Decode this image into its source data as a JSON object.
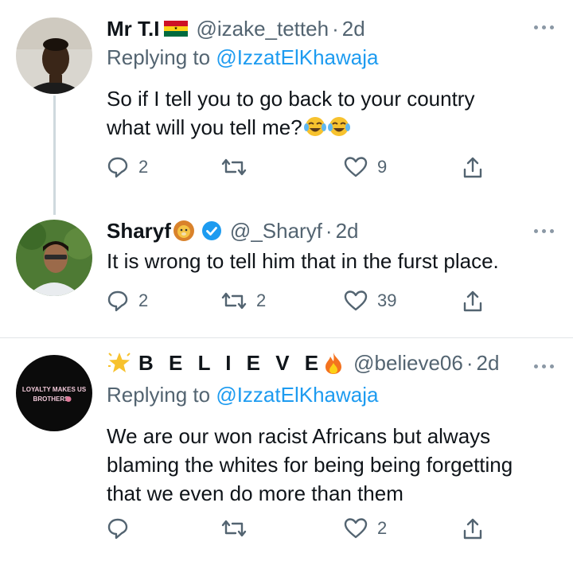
{
  "tweets": [
    {
      "name": "Mr T.I",
      "flag_icon": "ghana-flag-icon",
      "handle": "@izake_tetteh",
      "sep": "·",
      "time": "2d",
      "replying_prefix": "Replying to ",
      "replying_to": "@IzzatElKhawaja",
      "text_line1": "So if I tell you to go back to your country",
      "text_line2": "what will you tell me?",
      "text_emoji": "tears-of-joy-emoji",
      "reply_count": "2",
      "retweet_count": "",
      "like_count": "9"
    },
    {
      "name": "Sharyf",
      "name_emoji": "lion-face-emoji",
      "verified_icon": "verified-badge-icon",
      "handle": "@_Sharyf",
      "sep": "·",
      "time": "2d",
      "text": "It is wrong to tell him that in the furst place.",
      "reply_count": "2",
      "retweet_count": "2",
      "like_count": "39"
    },
    {
      "name_prefix_emoji": "glowing-star-emoji",
      "name": "B E L I E V E",
      "name_emoji": "fire-emoji",
      "handle": "@believe06",
      "sep": "·",
      "time": "2d",
      "replying_prefix": "Replying to ",
      "replying_to": "@IzzatElKhawaja",
      "avatar_text_line1": "LOYALTY MAKES US",
      "avatar_text_line2": "BROTHERS",
      "text_line1": "We are our won racist Africans but always",
      "text_line2": "blaming the whites for being being forgetting",
      "text_line3": "that we even do more than them",
      "reply_count": "",
      "retweet_count": "",
      "like_count": "2"
    }
  ],
  "colors": {
    "text": "#0f1419",
    "secondary": "#536471",
    "mention": "#1d9bf0",
    "verified": "#1d9bf0",
    "divider": "#e1e4e7"
  }
}
